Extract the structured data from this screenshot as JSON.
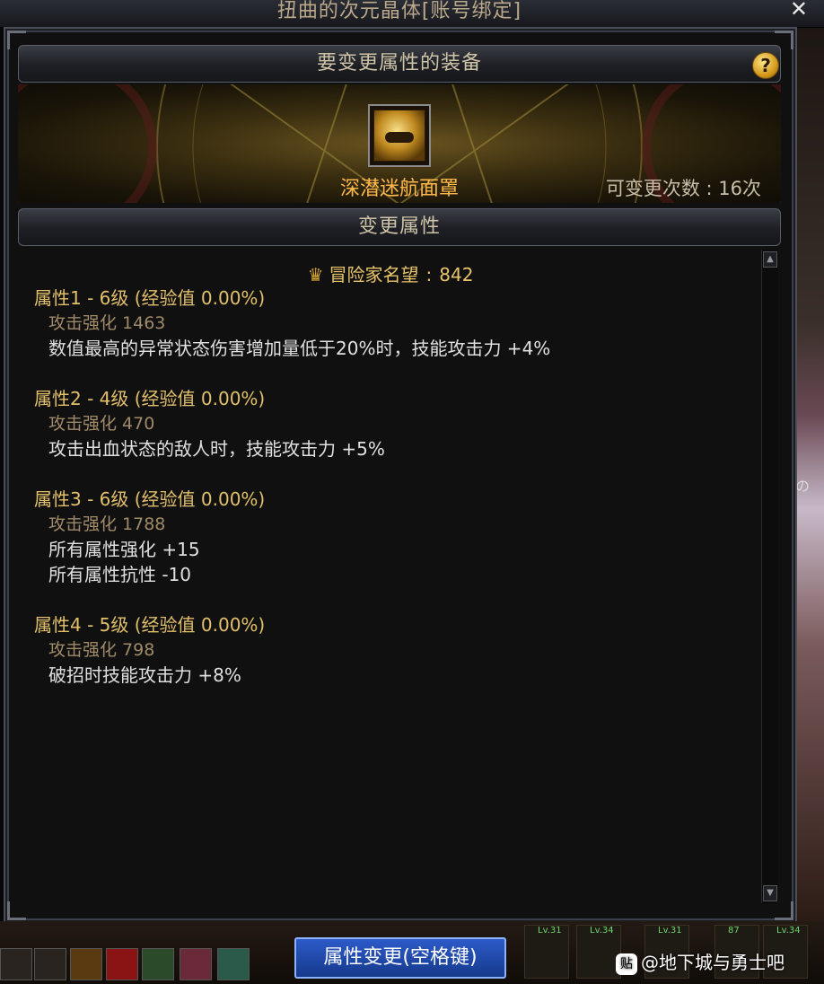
{
  "window": {
    "title": "扭曲的次元晶体[账号绑定]",
    "close_label": "✕"
  },
  "equipment_section": {
    "header": "要变更属性的装备",
    "help_label": "?",
    "item_name": "深潜迷航面罩",
    "change_count_label": "可变更次数",
    "change_count_value": "16次"
  },
  "attributes_section": {
    "header": "变更属性",
    "fame_label": "冒险家名望",
    "fame_value": "842",
    "attributes": [
      {
        "title": "属性1 - 6级 (经验值 0.00%)",
        "sub": "攻击强化 1463",
        "effects": [
          "数值最高的异常状态伤害增加量低于20%时，技能攻击力 +4%"
        ]
      },
      {
        "title": "属性2 - 4级 (经验值 0.00%)",
        "sub": "攻击强化 470",
        "effects": [
          "攻击出血状态的敌人时，技能攻击力 +5%"
        ]
      },
      {
        "title": "属性3 - 6级 (经验值 0.00%)",
        "sub": "攻击强化 1788",
        "effects": [
          "所有属性强化 +15",
          "所有属性抗性 -10"
        ]
      },
      {
        "title": "属性4 - 5级 (经验值 0.00%)",
        "sub": "攻击强化 798",
        "effects": [
          "破招时技能攻击力 +8%"
        ]
      }
    ]
  },
  "bottom": {
    "confirm_button": "属性变更(空格键)",
    "watermark": "@地下城与勇士吧",
    "watermark_icon": "贴",
    "right_levels": [
      "Lv.31",
      "Lv.34",
      "Lv.31",
      "87",
      "Lv.34"
    ],
    "overlay_text": "の"
  },
  "colors": {
    "title_gold": "#e2c06a",
    "item_orange": "#ffb84a",
    "button_blue": "#2c5ac8"
  }
}
